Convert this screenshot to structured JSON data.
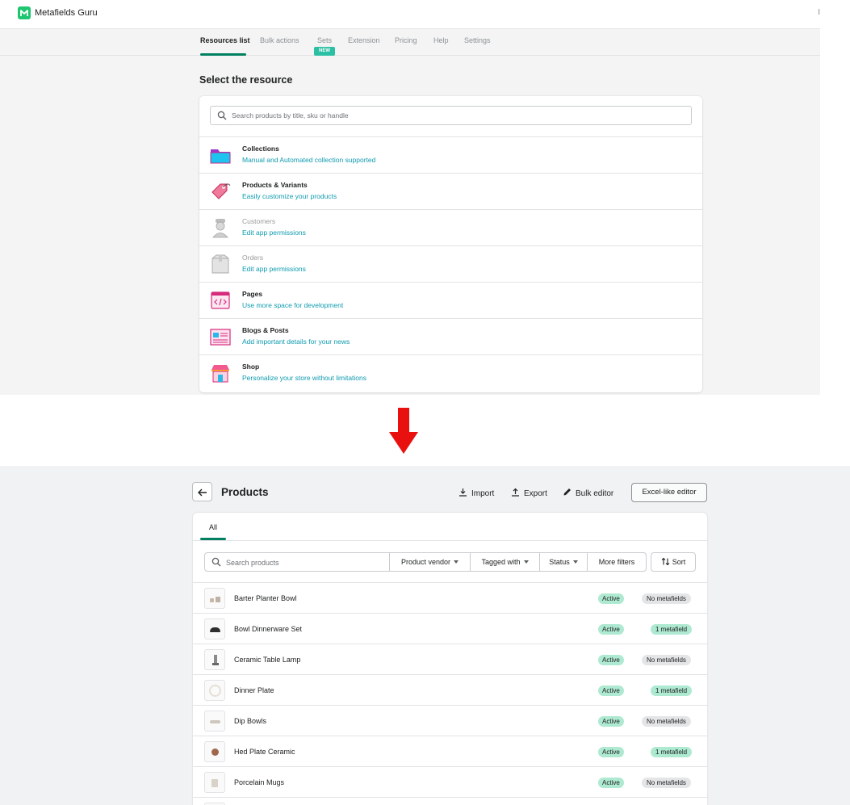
{
  "colors": {
    "brand_green": "#008060",
    "arrow_red": "#e8110f",
    "teal_link": "#0f9bb0",
    "active_badge": "#aee9d1"
  },
  "top": {
    "app": {
      "title": "Metafields Guru",
      "edge_text": "I"
    },
    "tabs": [
      "Resources list",
      "Bulk actions",
      "Sets",
      "Extension",
      "Pricing",
      "Help",
      "Settings"
    ],
    "active_tab": "Resources list",
    "new_badge": "NEW",
    "heading": "Select the resource",
    "search_placeholder": "Search products by title, sku or handle",
    "resources": [
      {
        "title": "Collections",
        "subtitle": "Manual and Automated collection supported",
        "icon": "folder-icon",
        "enabled": true
      },
      {
        "title": "Products & Variants",
        "subtitle": "Easily customize your products",
        "icon": "price-tag-icon",
        "enabled": true
      },
      {
        "title": "Customers",
        "subtitle": "Edit app permissions",
        "icon": "customer-icon",
        "enabled": false
      },
      {
        "title": "Orders",
        "subtitle": "Edit app permissions",
        "icon": "box-icon",
        "enabled": false
      },
      {
        "title": "Pages",
        "subtitle": "Use more space for development",
        "icon": "code-page-icon",
        "enabled": true
      },
      {
        "title": "Blogs & Posts",
        "subtitle": "Add important details for your news",
        "icon": "newspaper-icon",
        "enabled": true
      },
      {
        "title": "Shop",
        "subtitle": "Personalize your store without limitations",
        "icon": "storefront-icon",
        "enabled": true
      }
    ]
  },
  "bottom": {
    "title": "Products",
    "actions": {
      "import": "Import",
      "export": "Export",
      "bulk_editor": "Bulk editor",
      "excel_editor": "Excel-like editor"
    },
    "tab_all": "All",
    "search_placeholder": "Search products",
    "filters": [
      "Product vendor",
      "Tagged with",
      "Status",
      "More filters"
    ],
    "sort": "Sort",
    "products": [
      {
        "name": "Barter Planter Bowl",
        "status": "Active",
        "metafields": "No metafields",
        "has_metafields": false
      },
      {
        "name": "Bowl Dinnerware Set",
        "status": "Active",
        "metafields": "1 metafield",
        "has_metafields": true
      },
      {
        "name": "Ceramic Table Lamp",
        "status": "Active",
        "metafields": "No metafields",
        "has_metafields": false
      },
      {
        "name": "Dinner Plate",
        "status": "Active",
        "metafields": "1 metafield",
        "has_metafields": true
      },
      {
        "name": "Dip Bowls",
        "status": "Active",
        "metafields": "No metafields",
        "has_metafields": false
      },
      {
        "name": "Hed Plate Ceramic",
        "status": "Active",
        "metafields": "1 metafield",
        "has_metafields": true
      },
      {
        "name": "Porcelain Mugs",
        "status": "Active",
        "metafields": "No metafields",
        "has_metafields": false
      }
    ]
  }
}
